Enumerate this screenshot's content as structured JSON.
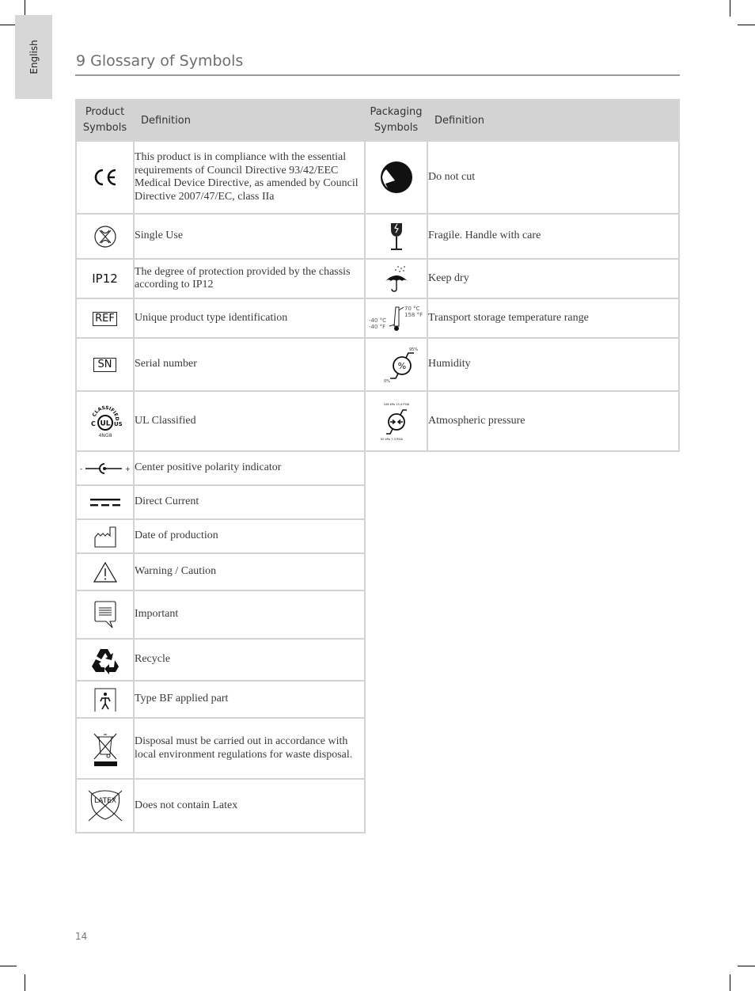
{
  "side_tab": {
    "label": "English"
  },
  "page": {
    "title": "9 Glossary of Symbols",
    "number": "14"
  },
  "product_table": {
    "header": {
      "symbols_line1": "Product",
      "symbols_line2": "Symbols",
      "definition": "Definition"
    },
    "rows": [
      {
        "icon": "ce-mark-icon",
        "definition": "This product is in compliance with the essential requirements of Council Directive 93/42/EEC Medical Device Directive, as amended by Council Directive 2007/47/EC, class IIa"
      },
      {
        "icon": "single-use-icon",
        "definition": "Single Use"
      },
      {
        "icon": "ip12-icon",
        "icon_text": "IP12",
        "definition": "The degree of protection provided by the chassis according to IP12"
      },
      {
        "icon": "ref-icon",
        "icon_text": "REF",
        "definition": "Unique product type identification"
      },
      {
        "icon": "sn-icon",
        "icon_text": "SN",
        "definition": "Serial number"
      },
      {
        "icon": "ul-classified-icon",
        "icon_text_top": "CLASSIFIED",
        "icon_text_c": "C",
        "icon_text_ul": "UL",
        "icon_text_us": "US",
        "icon_text_code": "4NG8",
        "definition": "UL Classified"
      },
      {
        "icon": "center-positive-polarity-icon",
        "icon_text_minus": "-",
        "icon_text_plus": "+",
        "definition": "Center positive polarity indicator"
      },
      {
        "icon": "direct-current-icon",
        "definition": "Direct Current"
      },
      {
        "icon": "date-of-production-icon",
        "definition": "Date of  production"
      },
      {
        "icon": "warning-icon",
        "definition": "Warning / Caution"
      },
      {
        "icon": "important-icon",
        "definition": "Important"
      },
      {
        "icon": "recycle-icon",
        "definition": "Recycle"
      },
      {
        "icon": "type-bf-applied-part-icon",
        "definition": "Type BF applied part"
      },
      {
        "icon": "weee-disposal-icon",
        "definition": "Disposal must be carried out in accordance with local environment regulations for waste disposal."
      },
      {
        "icon": "latex-free-icon",
        "icon_text": "LATEX",
        "definition": "Does not contain Latex"
      }
    ]
  },
  "packaging_table": {
    "header": {
      "symbols_line1": "Packaging",
      "symbols_line2": "Symbols",
      "definition": "Definition"
    },
    "rows": [
      {
        "icon": "do-not-cut-icon",
        "definition": "Do not cut"
      },
      {
        "icon": "fragile-icon",
        "definition": "Fragile. Handle with care"
      },
      {
        "icon": "keep-dry-icon",
        "definition": "Keep dry"
      },
      {
        "icon": "temperature-range-icon",
        "icon_text_high_c": "70 °C",
        "icon_text_high_f": "158 °F",
        "icon_text_low_c": "-40 °C",
        "icon_text_low_f": "-40 °F",
        "definition": "Transport storage temperature range"
      },
      {
        "icon": "humidity-icon",
        "icon_text_high": "95%",
        "icon_text_low": "0%",
        "definition": "Humidity"
      },
      {
        "icon": "atmospheric-pressure-icon",
        "icon_text_high": "106 kPa 15.4 PSIA",
        "icon_text_low": "50 kPa 7.3 PSIA",
        "definition": "Atmospheric pressure"
      }
    ]
  }
}
